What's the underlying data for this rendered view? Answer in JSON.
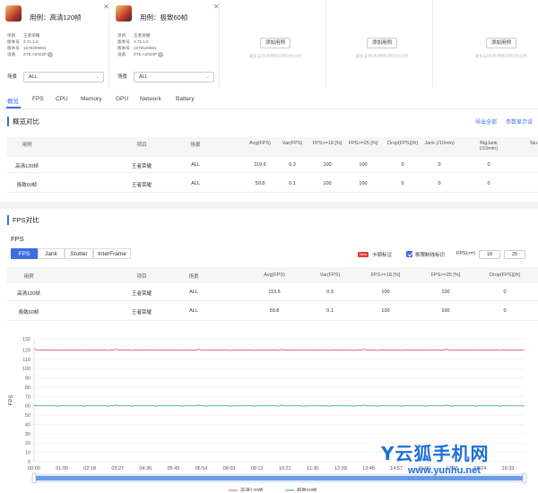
{
  "cards": [
    {
      "title": "用例：高清120帧",
      "meta": [
        {
          "k": "项目",
          "v": "王者荣耀"
        },
        {
          "k": "版本号",
          "v": "3.71.1.8"
        },
        {
          "k": "版本号",
          "v": "1578309851"
        },
        {
          "k": "设备",
          "v": "ZTE A2023P"
        }
      ]
    },
    {
      "title": "用例：极致60帧",
      "meta": [
        {
          "k": "项目",
          "v": "王者荣耀"
        },
        {
          "k": "版本号",
          "v": "3.75.1.8"
        },
        {
          "k": "版本号",
          "v": "1579549851"
        },
        {
          "k": "设备",
          "v": "ZTE A2023P"
        }
      ]
    }
  ],
  "scene_label": "场景",
  "scene_value": "ALL",
  "add_slots": [
    {
      "label": "添加用例",
      "hint": "最多支持5条用例同时对比分析"
    },
    {
      "label": "添加用例",
      "hint": "最多支持5条用例同时对比分析"
    },
    {
      "label": "添加用例",
      "hint": "最多支持5条用例同时对比分析"
    }
  ],
  "tabs": [
    "概览",
    "FPS",
    "CPU",
    "Memory",
    "GPU",
    "Network",
    "Battery"
  ],
  "overview": {
    "title": "概览对比",
    "export": "导出全部",
    "params": "参数显示设",
    "headers": [
      "用例",
      "项目",
      "场景",
      "Avg(FPS)",
      "Var(FPS)",
      "FPS>=18 [%]",
      "FPS>=25 [%]",
      "Drop(FPS)[/h]",
      "Jank (/10min)",
      "BigJank (/10min)",
      "Stu"
    ],
    "rows": [
      [
        "高清120帧",
        "王者荣耀",
        "ALL",
        "119.6",
        "0.3",
        "100",
        "100",
        "0",
        "0",
        "0"
      ],
      [
        "极致60帧",
        "王者荣耀",
        "ALL",
        "59.8",
        "0.1",
        "100",
        "100",
        "0",
        "0",
        "0"
      ]
    ]
  },
  "fps": {
    "title": "FPS对比",
    "subtitle": "FPS",
    "subtabs": [
      "FPS",
      "Jank",
      "Stutter",
      "InterFrame"
    ],
    "new": "New",
    "opt1": "卡顿标注",
    "opt2": "帧限制线标识",
    "fps_le": "FPS(>=)",
    "v1": "18",
    "v2": "25",
    "headers": [
      "用例",
      "项目",
      "场景",
      "Avg(FPS)",
      "Var(FPS)",
      "FPS>=18 [%]",
      "FPS>=25 [%]",
      "Drop(FPS)[/h]"
    ],
    "rows": [
      [
        "高清120帧",
        "王者荣耀",
        "ALL",
        "119.6",
        "0.3",
        "100",
        "100",
        "0"
      ],
      [
        "极致60帧",
        "王者荣耀",
        "ALL",
        "59.8",
        "0.1",
        "100",
        "100",
        "0"
      ]
    ]
  },
  "chart_data": {
    "type": "line",
    "ylabel": "FPS",
    "ylim": [
      0,
      132
    ],
    "yticks": [
      "0",
      "10",
      "20",
      "30",
      "40",
      "50",
      "60",
      "70",
      "80",
      "90",
      "100",
      "110",
      "120",
      "132"
    ],
    "x": [
      "00:00",
      "01:09",
      "02:18",
      "03:27",
      "04:36",
      "05:45",
      "06:54",
      "08:03",
      "09:12",
      "10:21",
      "11:30",
      "12:39",
      "13:48",
      "14:57",
      "16:06",
      "17:15",
      "18:24",
      "19:33"
    ],
    "series": [
      {
        "name": "高清120帧",
        "color": "#d6518f",
        "value": 120
      },
      {
        "name": "极致60帧",
        "color": "#28a07a",
        "value": 60
      }
    ]
  },
  "watermark": {
    "brand": "Y云狐手机网",
    "url": "www.yunhu.net"
  }
}
